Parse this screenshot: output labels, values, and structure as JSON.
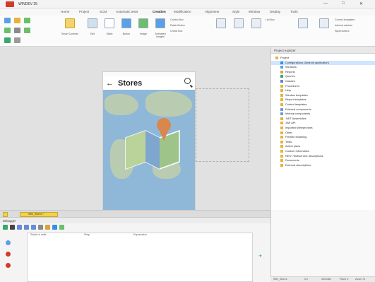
{
  "app": {
    "title": "WINDEV 25",
    "window_controls": [
      "—",
      "□",
      "✕"
    ]
  },
  "ribbon_tabs": [
    {
      "label": "Home",
      "active": false
    },
    {
      "label": "Project",
      "active": false
    },
    {
      "label": "SCM",
      "active": false
    },
    {
      "label": "Automatic tests",
      "active": false
    },
    {
      "label": "Creation",
      "active": true
    },
    {
      "label": "Modification",
      "active": false
    },
    {
      "label": "Alignment",
      "active": false
    },
    {
      "label": "Style",
      "active": false
    },
    {
      "label": "Window",
      "active": false
    },
    {
      "label": "Display",
      "active": false
    },
    {
      "label": "Tools",
      "active": false
    }
  ],
  "ribbon": {
    "groups": [
      {
        "label": "Smart Controls"
      },
      {
        "label": "Edit"
      },
      {
        "label": "Static"
      },
      {
        "label": "Button"
      },
      {
        "label": "Image"
      },
      {
        "label": "Animated Images"
      }
    ],
    "small_buttons": [
      "Combo Box",
      "Radio Button",
      "Check Box"
    ],
    "right_small": [
      "Control templates",
      "Internal window",
      "Supercontrol"
    ],
    "list_items": [
      "List Box",
      "Looper",
      "Table",
      "Layout",
      "Tab and associated"
    ]
  },
  "editor": {
    "phone": {
      "title": "Stores",
      "back_symbol": "←"
    }
  },
  "project_explorer": {
    "header": "Project explorer",
    "items": [
      {
        "label": "Project",
        "level": 0,
        "color": "#e8b23a"
      },
      {
        "label": "Configurations (Android application)",
        "level": 1,
        "color": "#3a8ee8",
        "selected": true
      },
      {
        "label": "Windows",
        "level": 1,
        "color": "#5aa0e8"
      },
      {
        "label": "Reports",
        "level": 1,
        "color": "#d9a23c"
      },
      {
        "label": "Queries",
        "level": 1,
        "color": "#3aa86a"
      },
      {
        "label": "Classes",
        "level": 1,
        "color": "#6a7fd8"
      },
      {
        "label": "Procedures",
        "level": 1,
        "color": "#e8b23a"
      },
      {
        "label": "Help",
        "level": 1,
        "color": "#e8b23a"
      },
      {
        "label": "Window templates",
        "level": 1,
        "color": "#e8b23a"
      },
      {
        "label": "Report templates",
        "level": 1,
        "color": "#e8b23a"
      },
      {
        "label": "Control templates",
        "level": 1,
        "color": "#e8b23a"
      },
      {
        "label": "External components",
        "level": 1,
        "color": "#6a9ad8"
      },
      {
        "label": "Internal components",
        "level": 1,
        "color": "#6a9ad8"
      },
      {
        "label": ".NET Assemblies",
        "level": 1,
        "color": "#e8b23a"
      },
      {
        "label": "JAR API",
        "level": 1,
        "color": "#e8b23a"
      },
      {
        "label": "Imported Webservices",
        "level": 1,
        "color": "#e8b23a"
      },
      {
        "label": "Other",
        "level": 1,
        "color": "#e8b23a"
      },
      {
        "label": "Flexible Modeling",
        "level": 1,
        "color": "#e8b23a"
      },
      {
        "label": "Tests",
        "level": 1,
        "color": "#e8b23a"
      },
      {
        "label": "Action plans",
        "level": 1,
        "color": "#e8b23a"
      },
      {
        "label": "Custom Information",
        "level": 1,
        "color": "#e8b23a"
      },
      {
        "label": "REST Webservice descriptions",
        "level": 1,
        "color": "#e8b23a"
      },
      {
        "label": "Documents",
        "level": 1,
        "color": "#e8b23a"
      },
      {
        "label": "External descriptions",
        "level": 1,
        "color": "#e8b23a"
      }
    ]
  },
  "doc_tab": {
    "label": "WIN_Stores *"
  },
  "debugger": {
    "title": "Debugger",
    "columns": [
      "Stack of calls",
      "Step",
      "Expression"
    ]
  },
  "statusbar": {
    "items": [
      "WIN_Stores",
      "0.0",
      "320x480",
      "Plane 0",
      "Zoom 75"
    ]
  },
  "colors": {
    "accent": "#3a8ee8",
    "doc_tab": "#f2d24a",
    "map_water": "#8fb8d8",
    "map_land": "#b9ccb2",
    "marker": "#d9874c"
  }
}
